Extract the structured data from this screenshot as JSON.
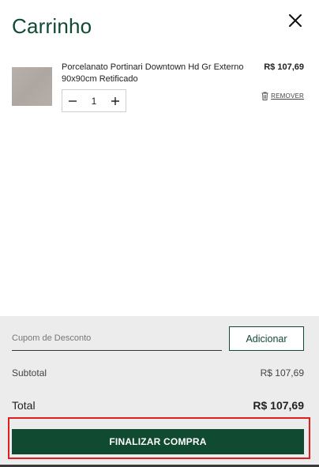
{
  "cart": {
    "title": "Carrinho",
    "close_icon": "close-icon"
  },
  "item": {
    "name": "Porcelanato Portinari Downtown Hd Gr Externo 90x90cm Retificado",
    "price": "R$ 107,69",
    "quantity": "1",
    "decrement_icon": "minus-icon",
    "increment_icon": "plus-icon",
    "remove_label": "REMOVER",
    "remove_icon": "trash-icon"
  },
  "coupon": {
    "placeholder": "Cupom de Desconto",
    "value": "",
    "add_label": "Adicionar"
  },
  "summary": {
    "subtotal_label": "Subtotal",
    "subtotal_value": "R$ 107,69",
    "total_label": "Total",
    "total_value": "R$ 107,69"
  },
  "checkout": {
    "label": "FINALIZAR COMPRA"
  },
  "colors": {
    "brand_green": "#0f4a31",
    "highlight_red": "#e01e1e",
    "footer_bg": "#ececec"
  }
}
